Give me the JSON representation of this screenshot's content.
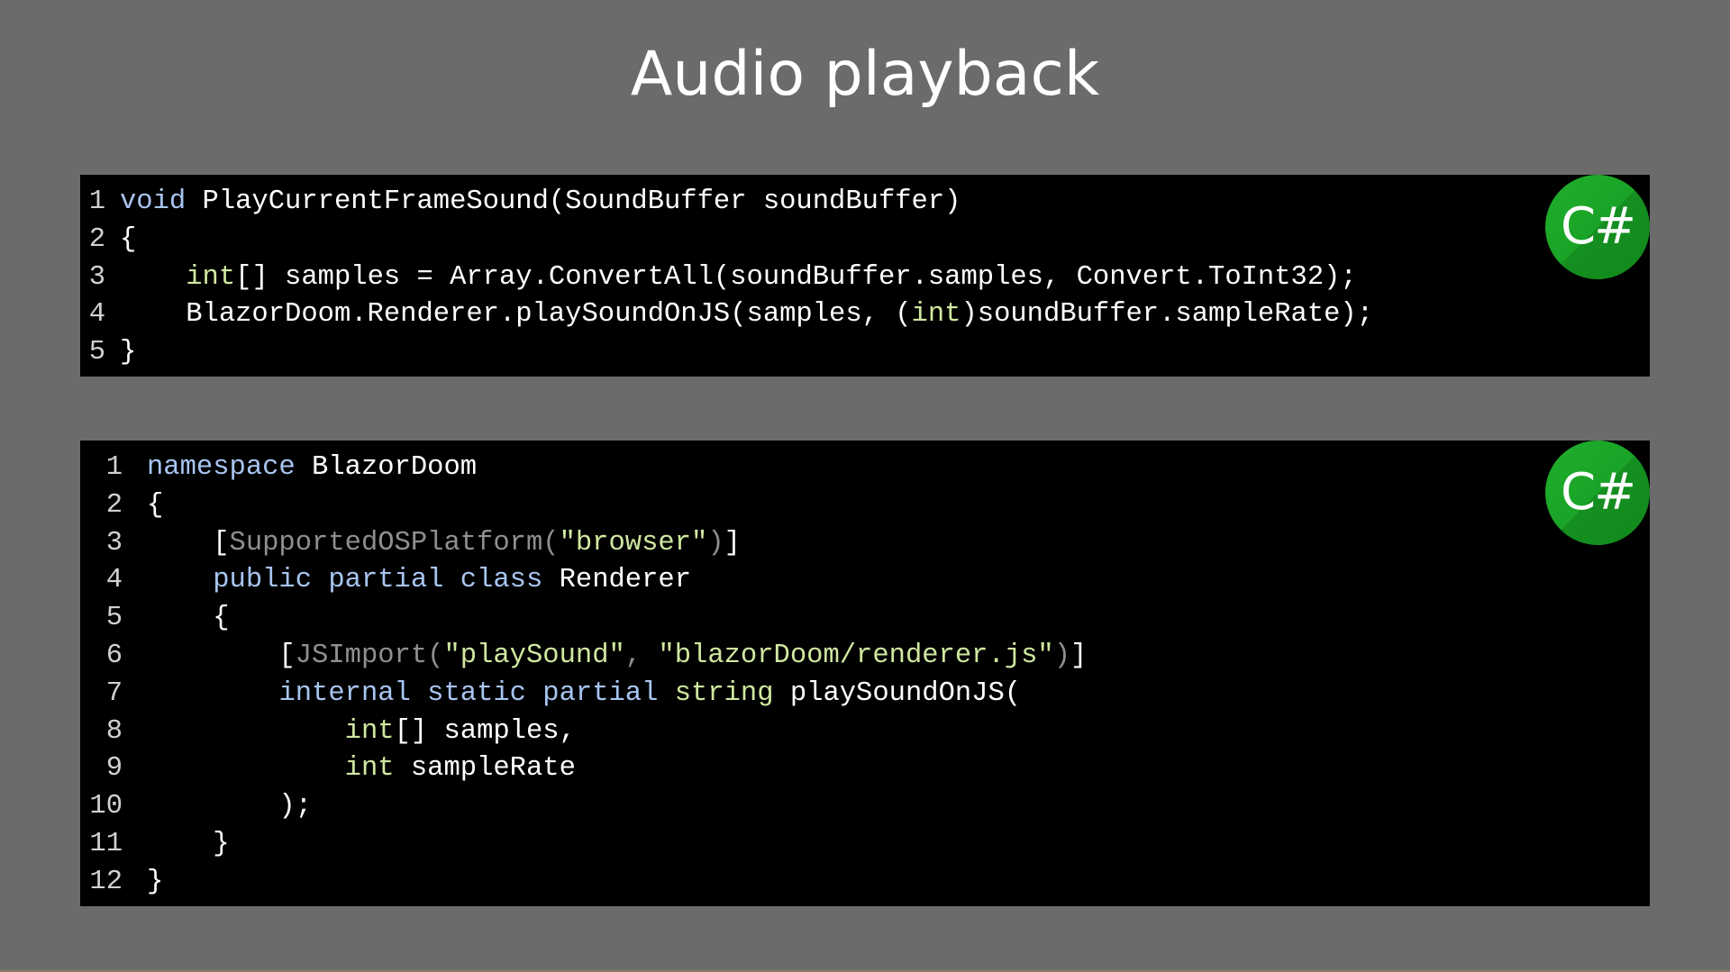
{
  "slide": {
    "title": "Audio playback"
  },
  "badge": {
    "label": "C#",
    "icon": "csharp-logo-icon",
    "color": "#1aa327"
  },
  "colors": {
    "background": "#6b6b6b",
    "code_background": "#000000",
    "keyword": "#a8c4f0",
    "type": "#cfe8a0",
    "string": "#cfe8a0",
    "attribute": "#8f8f8f",
    "plain": "#ffffff"
  },
  "snippets": [
    {
      "language": "C#",
      "lines": [
        {
          "n": "1",
          "tokens": [
            {
              "t": "keyword",
              "v": "void"
            },
            {
              "t": "plain",
              "v": " PlayCurrentFrameSound(SoundBuffer soundBuffer)"
            }
          ]
        },
        {
          "n": "2",
          "tokens": [
            {
              "t": "plain",
              "v": "{"
            }
          ]
        },
        {
          "n": "3",
          "tokens": [
            {
              "t": "plain",
              "v": "    "
            },
            {
              "t": "type",
              "v": "int"
            },
            {
              "t": "plain",
              "v": "[] samples = Array.ConvertAll(soundBuffer.samples, Convert.ToInt32);"
            }
          ]
        },
        {
          "n": "4",
          "tokens": [
            {
              "t": "plain",
              "v": "    BlazorDoom.Renderer.playSoundOnJS(samples, ("
            },
            {
              "t": "type",
              "v": "int"
            },
            {
              "t": "plain",
              "v": ")soundBuffer.sampleRate);"
            }
          ]
        },
        {
          "n": "5",
          "tokens": [
            {
              "t": "plain",
              "v": "}"
            }
          ]
        }
      ]
    },
    {
      "language": "C#",
      "lines": [
        {
          "n": "1",
          "tokens": [
            {
              "t": "keyword",
              "v": "namespace"
            },
            {
              "t": "plain",
              "v": " BlazorDoom"
            }
          ]
        },
        {
          "n": "2",
          "tokens": [
            {
              "t": "plain",
              "v": "{"
            }
          ]
        },
        {
          "n": "3",
          "tokens": [
            {
              "t": "plain",
              "v": "    ["
            },
            {
              "t": "attr",
              "v": "SupportedOSPlatform("
            },
            {
              "t": "string",
              "v": "\"browser\""
            },
            {
              "t": "attr",
              "v": ")"
            },
            {
              "t": "plain",
              "v": "]"
            }
          ]
        },
        {
          "n": "4",
          "tokens": [
            {
              "t": "plain",
              "v": "    "
            },
            {
              "t": "keyword",
              "v": "public partial class"
            },
            {
              "t": "plain",
              "v": " Renderer"
            }
          ]
        },
        {
          "n": "5",
          "tokens": [
            {
              "t": "plain",
              "v": "    {"
            }
          ]
        },
        {
          "n": "6",
          "tokens": [
            {
              "t": "plain",
              "v": "        ["
            },
            {
              "t": "attr",
              "v": "JSImport("
            },
            {
              "t": "string",
              "v": "\"playSound\""
            },
            {
              "t": "attr",
              "v": ", "
            },
            {
              "t": "string",
              "v": "\"blazorDoom/renderer.js\""
            },
            {
              "t": "attr",
              "v": ")"
            },
            {
              "t": "plain",
              "v": "]"
            }
          ]
        },
        {
          "n": "7",
          "tokens": [
            {
              "t": "plain",
              "v": "        "
            },
            {
              "t": "keyword",
              "v": "internal static partial"
            },
            {
              "t": "plain",
              "v": " "
            },
            {
              "t": "type",
              "v": "string"
            },
            {
              "t": "plain",
              "v": " playSoundOnJS("
            }
          ]
        },
        {
          "n": "8",
          "tokens": [
            {
              "t": "plain",
              "v": "            "
            },
            {
              "t": "type",
              "v": "int"
            },
            {
              "t": "plain",
              "v": "[] samples,"
            }
          ]
        },
        {
          "n": "9",
          "tokens": [
            {
              "t": "plain",
              "v": "            "
            },
            {
              "t": "type",
              "v": "int"
            },
            {
              "t": "plain",
              "v": " sampleRate"
            }
          ]
        },
        {
          "n": "10",
          "tokens": [
            {
              "t": "plain",
              "v": "        );"
            }
          ]
        },
        {
          "n": "11",
          "tokens": [
            {
              "t": "plain",
              "v": "    }"
            }
          ]
        },
        {
          "n": "12",
          "tokens": [
            {
              "t": "plain",
              "v": "}"
            }
          ]
        }
      ]
    }
  ]
}
